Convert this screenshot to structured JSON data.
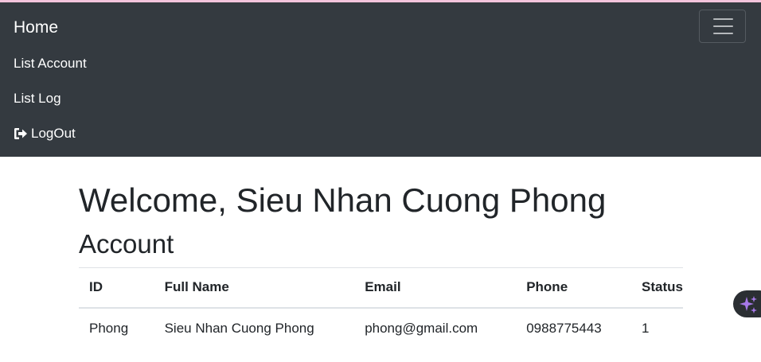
{
  "navbar": {
    "brand": "Home",
    "toggler_icon": "hamburger-menu-icon",
    "links": [
      {
        "label": "List Account"
      },
      {
        "label": "List Log"
      },
      {
        "label": "LogOut",
        "icon": "sign-out-icon"
      }
    ]
  },
  "main": {
    "welcome": "Welcome, Sieu Nhan Cuong Phong",
    "section_title": "Account"
  },
  "table": {
    "columns": [
      "ID",
      "Full Name",
      "Email",
      "Phone",
      "Status"
    ],
    "rows": [
      [
        "Phong",
        "Sieu Nhan Cuong Phong",
        "phong@gmail.com",
        "0988775443",
        "1"
      ]
    ]
  },
  "floating_button": {
    "icon": "sparkle-icon"
  },
  "colors": {
    "navbar_bg": "#343a40",
    "text": "#212529",
    "fab_accent": "#a779e9"
  }
}
